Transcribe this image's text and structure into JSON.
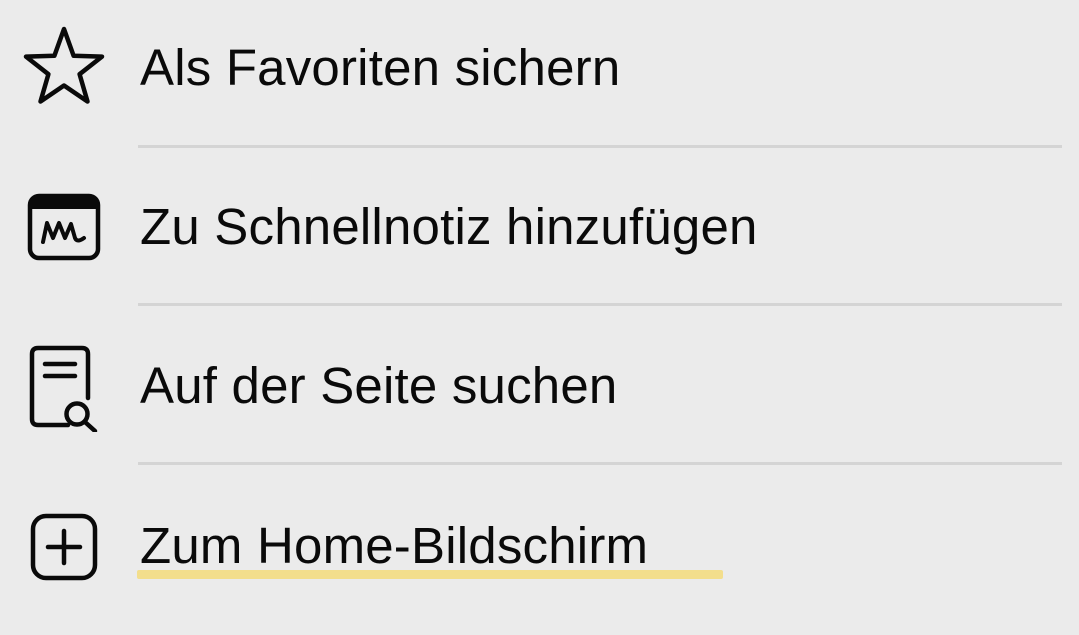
{
  "menu": {
    "items": [
      {
        "label": "Als Favoriten sichern",
        "icon": "star-icon"
      },
      {
        "label": "Zu Schnellnotiz hinzufügen",
        "icon": "quick-note-icon"
      },
      {
        "label": "Auf der Seite suchen",
        "icon": "find-on-page-icon"
      },
      {
        "label": "Zum Home-Bildschirm",
        "icon": "add-square-icon"
      }
    ]
  },
  "colors": {
    "background": "#ebebeb",
    "text": "#0a0a0a",
    "divider": "#d4d4d4",
    "underline_highlight": "#f3de8c"
  }
}
